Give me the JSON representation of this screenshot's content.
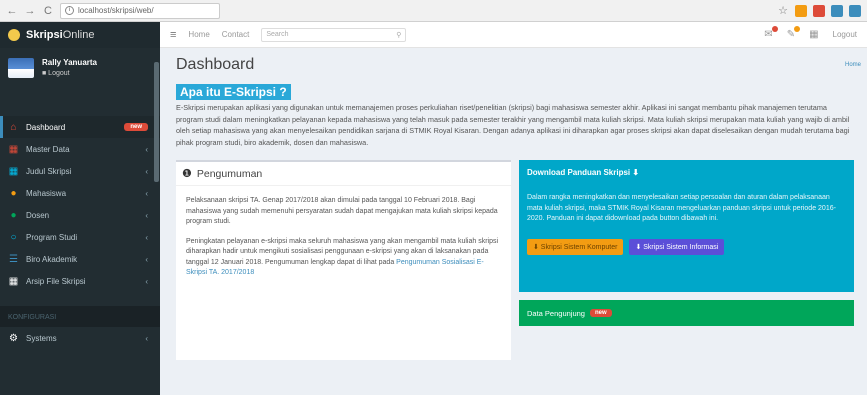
{
  "browser": {
    "back": "←",
    "forward": "→",
    "reload": "C",
    "url": "localhost/skripsi/web/"
  },
  "sidebar": {
    "app_name_bold": "Skripsi",
    "app_name_light": "Online",
    "user_name": "Rally Yanuarta",
    "user_status": "■ Logout",
    "items": [
      {
        "label": "Dashboard",
        "icon": "home-icon",
        "glyph": "⌂",
        "color": "#dd4b39",
        "badge": "new"
      },
      {
        "label": "Master Data",
        "icon": "grid-icon",
        "glyph": "▦",
        "color": "#dd4b39"
      },
      {
        "label": "Judul Skripsi",
        "icon": "table-icon",
        "glyph": "▦",
        "color": "#00c0ef"
      },
      {
        "label": "Mahasiswa",
        "icon": "user-icon",
        "glyph": "●",
        "color": "#f39c12"
      },
      {
        "label": "Dosen",
        "icon": "users-icon",
        "glyph": "●",
        "color": "#00a65a"
      },
      {
        "label": "Program Studi",
        "icon": "circle-icon",
        "glyph": "○",
        "color": "#00c0ef"
      },
      {
        "label": "Biro Akademik",
        "icon": "list-icon",
        "glyph": "☰",
        "color": "#3c8dbc"
      },
      {
        "label": "Arsip File Skripsi",
        "icon": "archive-icon",
        "glyph": "▦",
        "color": "#fff"
      }
    ],
    "section_header": "KONFIGURASI",
    "system_item": {
      "label": "Systems",
      "icon": "gears-icon",
      "glyph": "⚙"
    }
  },
  "navbar": {
    "home": "Home",
    "contact": "Contact",
    "search_placeholder": "Search",
    "logout": "Logout"
  },
  "page": {
    "title": "Dashboard",
    "breadcrumb": "Home",
    "apa_title": "Apa itu E-Skripsi ?",
    "intro": "E-Skripsi merupakan aplikasi yang digunakan untuk memanajemen proses perkuliahan riset/penelitian (skripsi) bagi mahasiswa semester akhir. Aplikasi ini sangat membantu pihak manajemen terutama program studi dalam meningkatkan pelayanan kepada mahasiswa yang telah masuk pada semester terakhir yang mengambil mata kuliah skripsi. Mata kuliah skripsi merupakan mata kuliah yang wajib di ambil oleh setiap mahasiswa yang akan menyelesaikan pendidikan sarjana di STMIK Royal Kisaran. Dengan adanya aplikasi ini diharapkan agar proses skripsi akan dapat diselesaikan dengan mudah terutama bagi pihak program studi, biro akademik, dosen dan mahasiswa."
  },
  "pengumuman": {
    "title": "Pengumuman",
    "p1": "Pelaksanaan skripsi TA. Genap 2017/2018 akan dimulai pada tanggal 10 Februari 2018. Bagi mahasiswa yang sudah memenuhi persyaratan sudah dapat mengajukan mata kuliah skripsi kepada program studi.",
    "p2": "Peningkatan pelayanan e-skripsi maka seluruh mahasiswa yang akan mengambil mata kuliah skripsi diharapkan hadir untuk mengikuti sosialisasi penggunaan e-skripsi yang akan di laksanakan pada tanggal 12 Januari 2018. Pengumuman lengkap dapat di lihat pada",
    "link": "Pengumuman Sosialisasi E-Skripsi TA. 2017/2018"
  },
  "download": {
    "title": "Download Panduan Skripsi ⬇",
    "body": "Dalam rangka meningkatkan dan menyelesaikan setiap persoalan dan aturan dalam pelaksanaan mata kuliah skripsi, maka STMIK Royal Kisaran mengeluarkan panduan skripsi untuk periode 2016-2020. Panduan ini dapat didownload pada button dibawah ini.",
    "btn_komputer": "⬇ Skripsi Sistem Komputer",
    "btn_informasi": "⬇ Skripsi Sistem Informasi"
  },
  "data_pengunjung": {
    "title": "Data Pengunjung",
    "badge": "new"
  },
  "colors": {
    "sidebar_bg": "#222d32",
    "accent_blue": "#3c8dbc",
    "teal": "#00a7c9",
    "green": "#00a65a",
    "warning": "#f39c12"
  }
}
